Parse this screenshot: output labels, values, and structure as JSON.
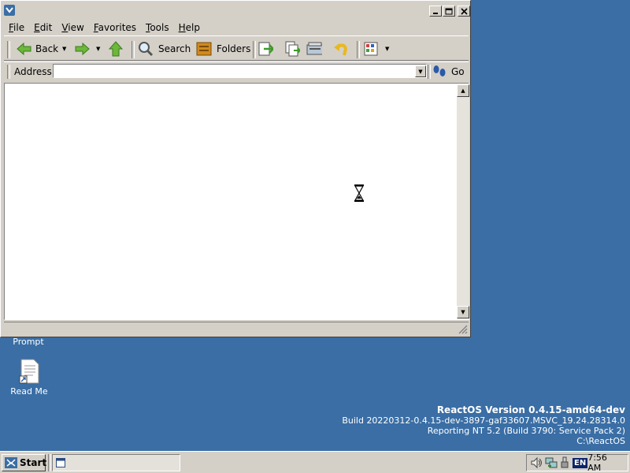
{
  "menubar": {
    "items": [
      {
        "label": "File",
        "u": "F",
        "rest": "ile"
      },
      {
        "label": "Edit",
        "u": "E",
        "rest": "dit"
      },
      {
        "label": "View",
        "u": "V",
        "rest": "iew"
      },
      {
        "label": "Favorites",
        "u": "F",
        "rest": "avorites"
      },
      {
        "label": "Tools",
        "u": "T",
        "rest": "ools"
      },
      {
        "label": "Help",
        "u": "H",
        "rest": "elp"
      }
    ]
  },
  "toolbar": {
    "back_label": "Back",
    "search_label": "Search",
    "folders_label": "Folders"
  },
  "addressbar": {
    "label": "Address",
    "value": "",
    "go_label": "Go"
  },
  "desktop": {
    "icons": [
      {
        "label": "Prompt"
      },
      {
        "label": "Read Me"
      }
    ]
  },
  "osinfo": {
    "line1": "ReactOS Version 0.4.15-amd64-dev",
    "line2": "Build 20220312-0.4.15-dev-3897-gaf33607.MSVC_19.24.28314.0",
    "line3": "Reporting NT 5.2 (Build 3790: Service Pack 2)",
    "line4": "C:\\ReactOS"
  },
  "taskbar": {
    "start_label": "Start",
    "lang": "EN",
    "clock": "7:56 AM"
  },
  "colors": {
    "desktop": "#3a6ea5",
    "face": "#d4d0c8"
  }
}
